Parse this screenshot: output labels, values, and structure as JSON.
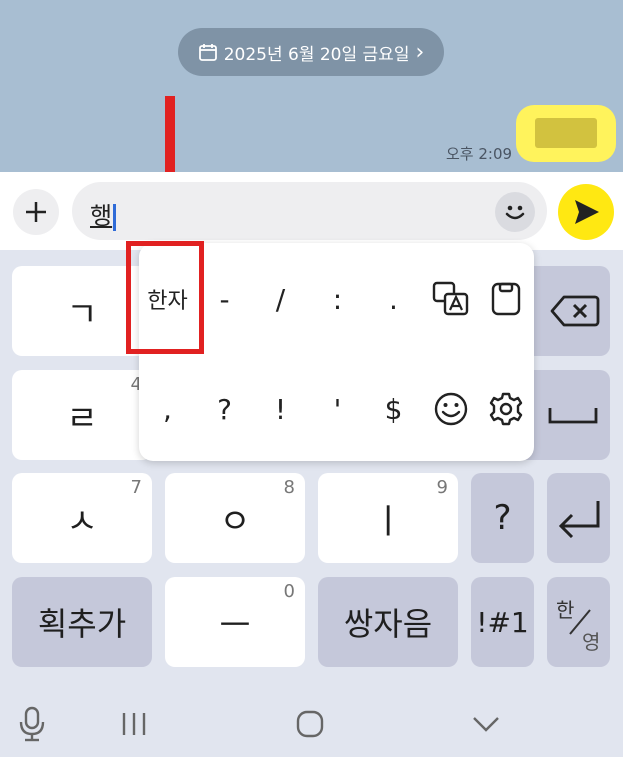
{
  "chat": {
    "date_label": "2025년 6월 20일 금요일",
    "date_chevron": "›",
    "message_time": "오후 2:09"
  },
  "input": {
    "typed_text": "행"
  },
  "popup": {
    "row1": [
      "한자",
      "-",
      "/",
      ":",
      "."
    ],
    "row2": [
      ",",
      "?",
      "!",
      "'",
      "$"
    ]
  },
  "keys": {
    "r1c1": "ㄱ",
    "r2c1": "ㄹ",
    "r2c1_sub": "4",
    "r3c1": "ㅅ",
    "r3c1_sub": "7",
    "r3c2": "ㅇ",
    "r3c2_sub": "8",
    "r3c3": "ㅣ",
    "r3c3_sub": "9",
    "r3c4": "?",
    "r4c1": "획추가",
    "r4c2": "ㅡ",
    "r4c2_sub": "0",
    "r4c3": "쌍자음",
    "r4c4": "!#1",
    "lang_top": "한",
    "lang_bottom": "영"
  },
  "colors": {
    "chat_bg": "#a8bed2",
    "keyboard_bg": "#e1e5ef",
    "send_button": "#ffe812",
    "highlight_box": "#e12121"
  }
}
